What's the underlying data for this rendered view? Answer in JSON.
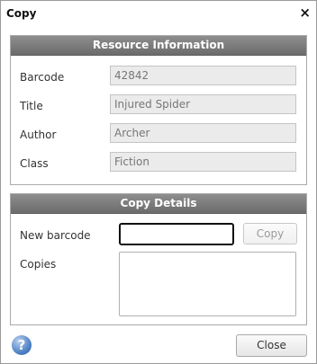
{
  "window": {
    "title": "Copy",
    "close_glyph": "×"
  },
  "resource": {
    "header": "Resource Information",
    "fields": [
      {
        "label": "Barcode",
        "value": "42842"
      },
      {
        "label": "Title",
        "value": "Injured Spider"
      },
      {
        "label": "Author",
        "value": "Archer"
      },
      {
        "label": "Class",
        "value": "Fiction"
      }
    ]
  },
  "copy": {
    "header": "Copy Details",
    "new_barcode_label": "New barcode",
    "new_barcode_value": "",
    "copy_button": "Copy",
    "copies_label": "Copies"
  },
  "footer": {
    "help_glyph": "?",
    "close_button": "Close"
  }
}
